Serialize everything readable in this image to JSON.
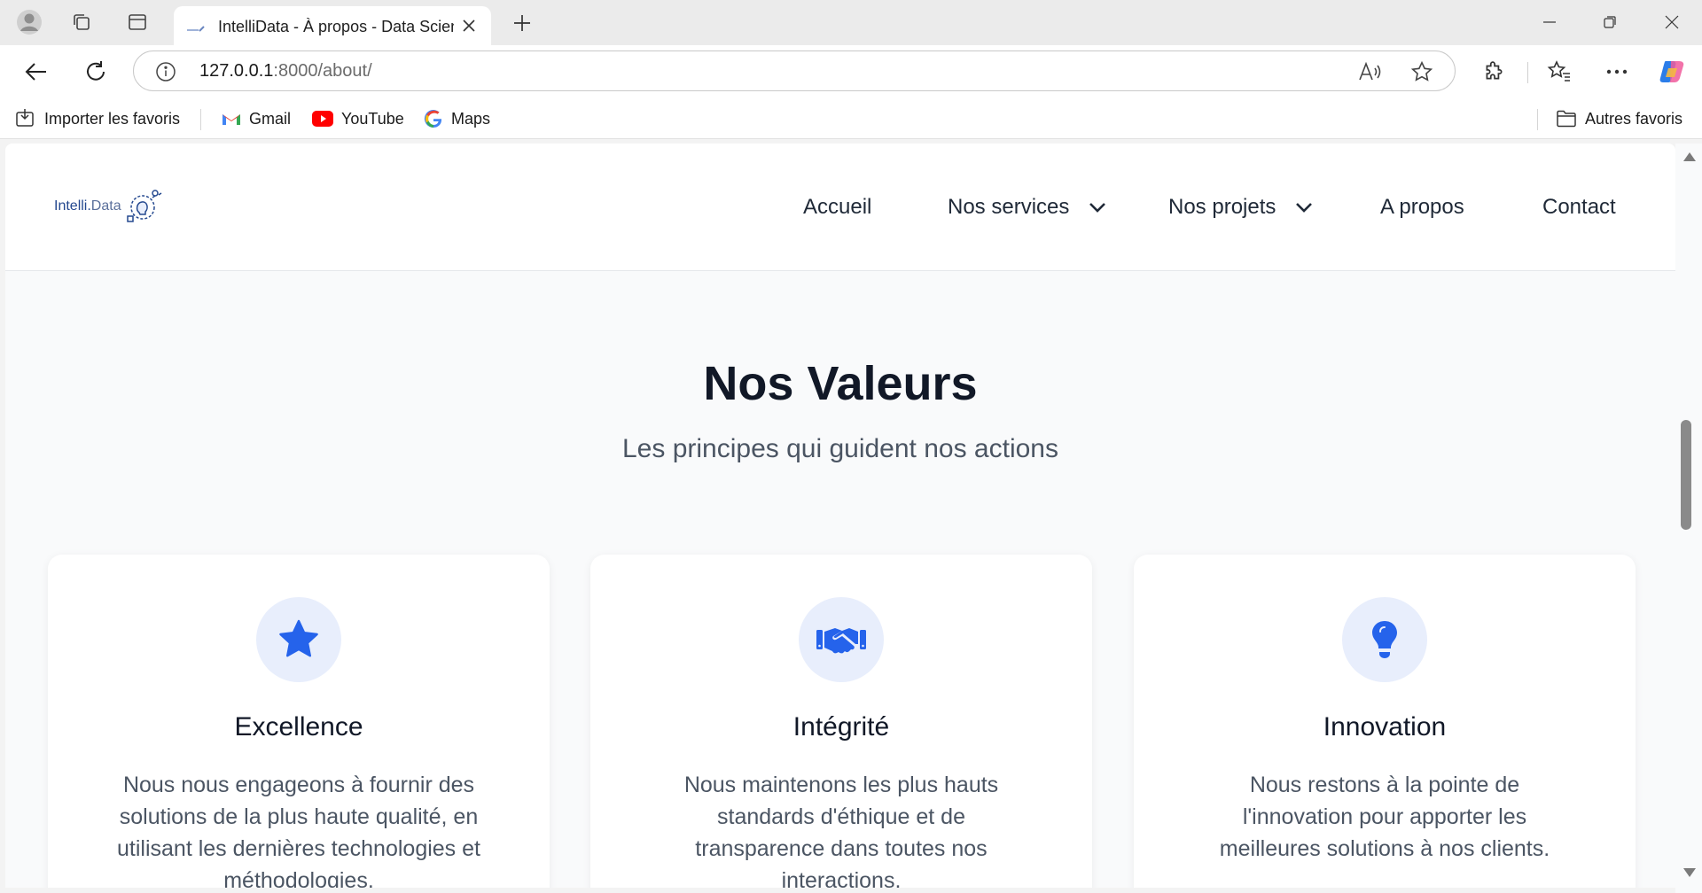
{
  "browser": {
    "tab_title": "IntelliData - À propos - Data Scien",
    "url_host": "127.0.0.1",
    "url_path": ":8000/about/",
    "bookmarks": {
      "import": "Importer les favoris",
      "gmail": "Gmail",
      "youtube": "YouTube",
      "maps": "Maps",
      "others": "Autres favoris"
    }
  },
  "site": {
    "logo": {
      "brand": "Intelli.",
      "brand_suffix": "Data"
    },
    "nav": {
      "home": "Accueil",
      "services": "Nos services",
      "projects": "Nos projets",
      "about": "A propos",
      "contact": "Contact"
    },
    "values": {
      "title": "Nos Valeurs",
      "subtitle": "Les principes qui guident nos actions",
      "cards": [
        {
          "icon": "star-icon",
          "title": "Excellence",
          "text": "Nous nous engageons à fournir des solutions de la plus haute qualité, en utilisant les dernières technologies et méthodologies."
        },
        {
          "icon": "handshake-icon",
          "title": "Intégrité",
          "text": "Nous maintenons les plus hauts standards d'éthique et de transparence dans toutes nos interactions."
        },
        {
          "icon": "lightbulb-icon",
          "title": "Innovation",
          "text": "Nous restons à la pointe de l'innovation pour apporter les meilleures solutions à nos clients."
        }
      ]
    }
  },
  "colors": {
    "accent": "#2563eb",
    "icon_bg": "#e8eefc",
    "heading": "#111827",
    "body_text": "#4b5563"
  }
}
